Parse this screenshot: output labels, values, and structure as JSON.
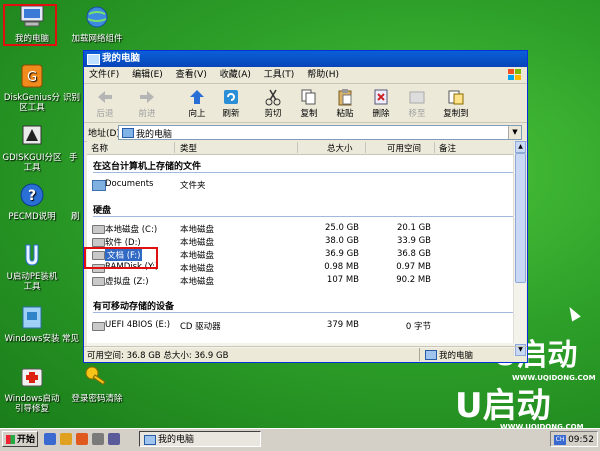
{
  "desktop": {
    "icons": [
      {
        "label": "我的电脑",
        "icon": "my-computer-icon"
      },
      {
        "label": "加载网络组件",
        "icon": "network-globe-icon"
      },
      {
        "label": "DiskGenius分区工具",
        "icon": "diskgenius-icon"
      },
      {
        "label": "识别",
        "icon": "partial-icon"
      },
      {
        "label": "GDISKGUI分区工具",
        "icon": "gdisk-icon"
      },
      {
        "label": "手",
        "icon": "partial-icon"
      },
      {
        "label": "PECMD说明",
        "icon": "help-icon"
      },
      {
        "label": "刷",
        "icon": "partial-icon"
      },
      {
        "label": "U启动PE装机工具",
        "icon": "uqidong-icon"
      },
      {
        "label": "Windows安装",
        "icon": "windows-install-icon"
      },
      {
        "label": "常见",
        "icon": "partial-icon"
      },
      {
        "label": "Windows启动引导修复",
        "icon": "boot-repair-icon"
      },
      {
        "label": "登录密码清除",
        "icon": "key-icon"
      }
    ],
    "brand_text": "U启动",
    "brand_url": "WWW.UQIDONG.COM"
  },
  "window": {
    "title": "我的电脑",
    "menu": [
      "文件(F)",
      "编辑(E)",
      "查看(V)",
      "收藏(A)",
      "工具(T)",
      "帮助(H)"
    ],
    "toolbar": {
      "back": "后退",
      "forward": "前进",
      "up": "向上",
      "refresh": "刷新",
      "cut": "剪切",
      "copy": "复制",
      "paste": "粘贴",
      "delete": "删除",
      "move": "移至",
      "copyto": "复制到"
    },
    "address": {
      "label": "地址(D)",
      "value": "我的电脑"
    },
    "columns": {
      "name": "名称",
      "type": "类型",
      "total": "总大小",
      "free": "可用空间",
      "note": "备注"
    },
    "groups": {
      "stored": "在这台计算机上存储的文件",
      "hdd": "硬盘",
      "removable": "有可移动存储的设备"
    },
    "stored_items": [
      {
        "name": "Documents",
        "type": "文件夹"
      }
    ],
    "drives": [
      {
        "name": "本地磁盘 (C:)",
        "type": "本地磁盘",
        "total": "25.0 GB",
        "free": "20.1 GB"
      },
      {
        "name": "软件 (D:)",
        "type": "本地磁盘",
        "total": "38.0 GB",
        "free": "33.9 GB"
      },
      {
        "name": "文档 (F:)",
        "type": "本地磁盘",
        "total": "36.9 GB",
        "free": "36.8 GB"
      },
      {
        "name": "RAMDisk (Y:)",
        "type": "本地磁盘",
        "total": "0.98 MB",
        "free": "0.97 MB"
      },
      {
        "name": "虚拟盘 (Z:)",
        "type": "本地磁盘",
        "total": "107 MB",
        "free": "90.2 MB"
      }
    ],
    "removable_items": [
      {
        "name": "UEFI 4BIOS (E:)",
        "type": "CD 驱动器",
        "total": "379 MB",
        "free": "0 字节"
      }
    ],
    "status": {
      "left": "可用空间: 36.8 GB 总大小: 36.9 GB",
      "right": "我的电脑"
    }
  },
  "taskbar": {
    "start": "开始",
    "task": "我的电脑",
    "tray_lang": "CH",
    "clock": "09:52"
  }
}
